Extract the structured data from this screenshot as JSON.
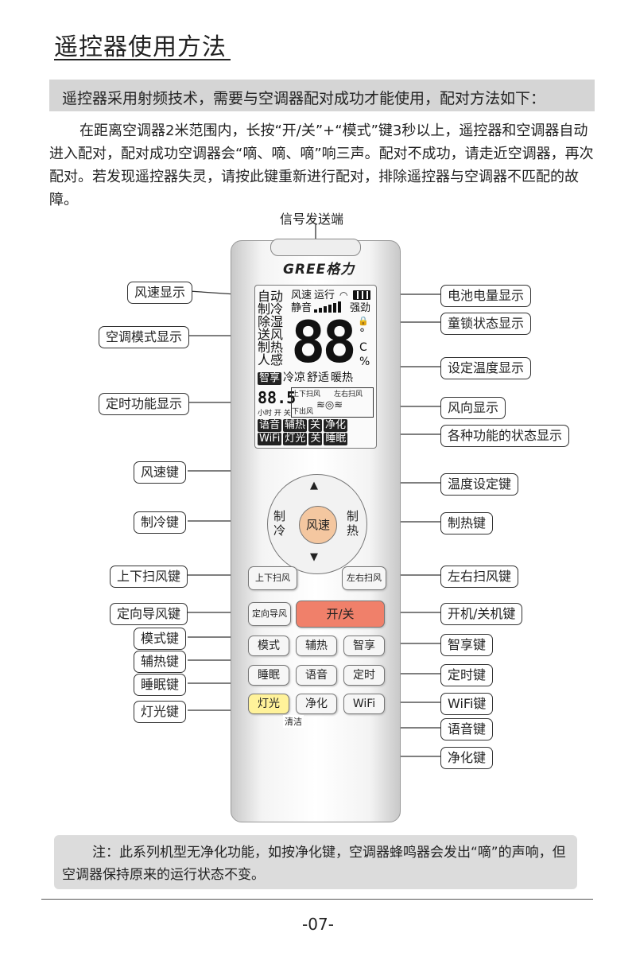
{
  "title": "遥控器使用方法",
  "intro_bar": "遥控器采用射频技术，需要与空调器配对成功才能使用，配对方法如下：",
  "paragraph": "在距离空调器2米范围内，长按“开/关”+“模式”键3秒以上，遥控器和空调器自动进入配对，配对成功空调器会“嘀、嘀、嘀”响三声。配对不成功，请走近空调器，再次配对。若发现遥控器失灵，请按此键重新进行配对，排除遥控器与空调器不匹配的故障。",
  "signal_label": "信号发送端",
  "logo": "GREE格力",
  "lcd": {
    "modes": [
      "自动",
      "制冷",
      "除湿",
      "送风",
      "制热",
      "人感"
    ],
    "fan_speed": "风速",
    "running": "运行",
    "mute": "静音",
    "strong": "强劲",
    "digits": "88",
    "units": "°C %",
    "row_mid": [
      "智享",
      "冷凉",
      "舒适",
      "暖热"
    ],
    "timer_digits": "88.5",
    "timer_text": "小时 开 关",
    "swing_up": "上下扫风",
    "swing_lr": "左右扫风",
    "swing_down": "下出风",
    "status_row1": [
      "语音",
      "辅热",
      "关",
      "净化"
    ],
    "status_row2": [
      "WiFi",
      "灯光",
      "关",
      "睡眠"
    ]
  },
  "buttons": {
    "up": "▲",
    "down": "▼",
    "fan": "风速",
    "cool": "制冷",
    "heat": "制热",
    "swing_ud": "上下扫风",
    "swing_lr": "左右扫风",
    "fixed_swing": "定向导风",
    "power": "开/关",
    "mode": "模式",
    "aux_heat": "辅热",
    "smart": "智享",
    "sleep": "睡眠",
    "voice": "语音",
    "timer": "定时",
    "light": "灯光",
    "purify": "净化",
    "wifi": "WiFi",
    "clean": "清洁"
  },
  "left_labels": [
    "风速显示",
    "空调模式显示",
    "定时功能显示",
    "风速键",
    "制冷键",
    "上下扫风键",
    "定向导风键",
    "模式键",
    "辅热键",
    "睡眠键",
    "灯光键"
  ],
  "right_labels": [
    "电池电量显示",
    "童锁状态显示",
    "设定温度显示",
    "风向显示",
    "各种功能的状态显示",
    "温度设定键",
    "制热键",
    "左右扫风键",
    "开机/关机键",
    "智享键",
    "定时键",
    "WiFi键",
    "语音键",
    "净化键"
  ],
  "note": "注：此系列机型无净化功能，如按净化键，空调器蜂鸣器会发出“嘀”的声响，但空调器保持原来的运行状态不变。",
  "page_number": "-07-",
  "colors": {
    "fan_button": "#f4c7a0",
    "power_button": "#f0806a",
    "light_button": "#fff29a",
    "bar_bg": "#d5d5d5"
  }
}
